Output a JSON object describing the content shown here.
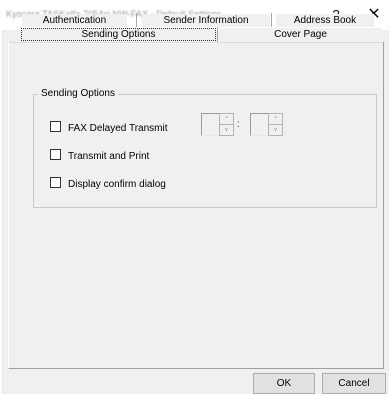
{
  "window": {
    "title": "Kyocera TASKalfa 7054ci NW-FAX - Default Settings",
    "help_label": "?",
    "close_label": "✕"
  },
  "tabs": {
    "back_row": [
      {
        "label": "Authentication"
      },
      {
        "label": "Sender Information"
      },
      {
        "label": "Address Book"
      }
    ],
    "front_row": [
      {
        "label": "Sending Options",
        "selected": true
      },
      {
        "label": "Cover Page",
        "selected": false
      }
    ]
  },
  "sending_options": {
    "group_label": "Sending Options",
    "fax_delayed_transmit": {
      "label": "FAX Delayed Transmit",
      "checked": false
    },
    "time_separator": ":",
    "spin_up_icon": "^",
    "spin_down_icon": "v",
    "transmit_and_print": {
      "label": "Transmit and Print",
      "checked": false
    },
    "display_confirm_dialog": {
      "label": "Display confirm dialog",
      "checked": false
    }
  },
  "buttons": {
    "ok_label": "OK",
    "cancel_label": "Cancel"
  }
}
